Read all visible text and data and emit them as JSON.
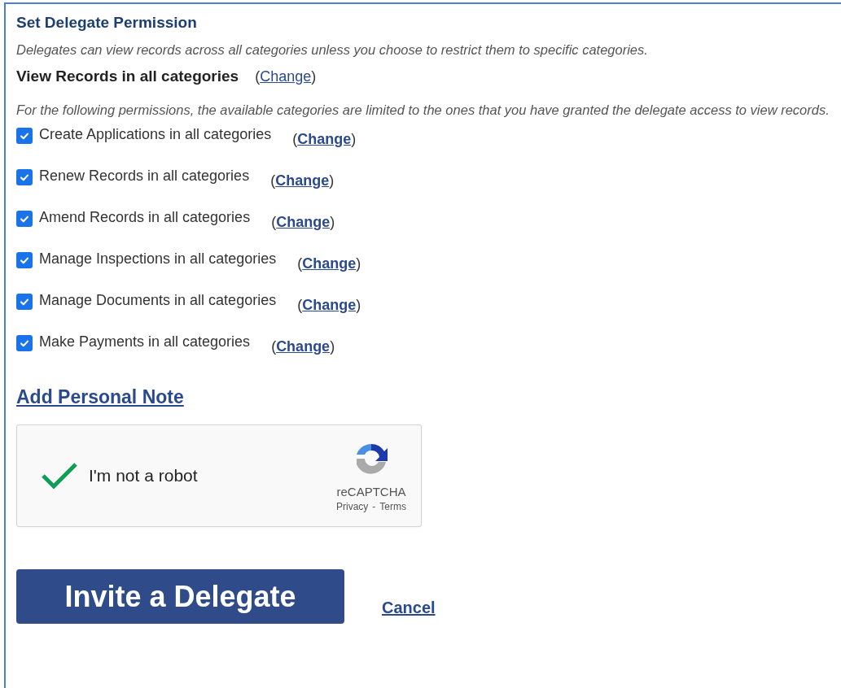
{
  "section": {
    "title": "Set Delegate Permission",
    "description": "Delegates can view records across all categories unless you choose to restrict them to specific categories.",
    "view_permission": {
      "label": "View Records in all categories",
      "change": {
        "before": "(",
        "link": "Change",
        "after": ")"
      }
    },
    "note": "For the following permissions, the available categories are limited to the ones that you have granted the delegate access to view records."
  },
  "permissions": [
    {
      "label": "Create Applications in all categories",
      "checked": true,
      "change": {
        "before": "(",
        "link": "Change",
        "after": ")"
      }
    },
    {
      "label": "Renew Records in all categories",
      "checked": true,
      "change": {
        "before": "(",
        "link": "Change",
        "after": ")"
      }
    },
    {
      "label": "Amend Records in all categories",
      "checked": true,
      "change": {
        "before": "(",
        "link": "Change",
        "after": ")"
      }
    },
    {
      "label": "Manage Inspections in all categories",
      "checked": true,
      "change": {
        "before": "(",
        "link": "Change",
        "after": ")"
      }
    },
    {
      "label": "Manage Documents in all categories",
      "checked": true,
      "change": {
        "before": "(",
        "link": "Change",
        "after": ")"
      }
    },
    {
      "label": "Make Payments in all categories",
      "checked": true,
      "change": {
        "before": "(",
        "link": "Change",
        "after": ")"
      }
    }
  ],
  "personal_note_link": "Add Personal Note",
  "captcha": {
    "checked": true,
    "label": "I'm not a robot",
    "brand": "reCAPTCHA",
    "privacy": "Privacy",
    "separator": "-",
    "terms": "Terms"
  },
  "buttons": {
    "invite": "Invite a Delegate",
    "cancel": "Cancel"
  }
}
